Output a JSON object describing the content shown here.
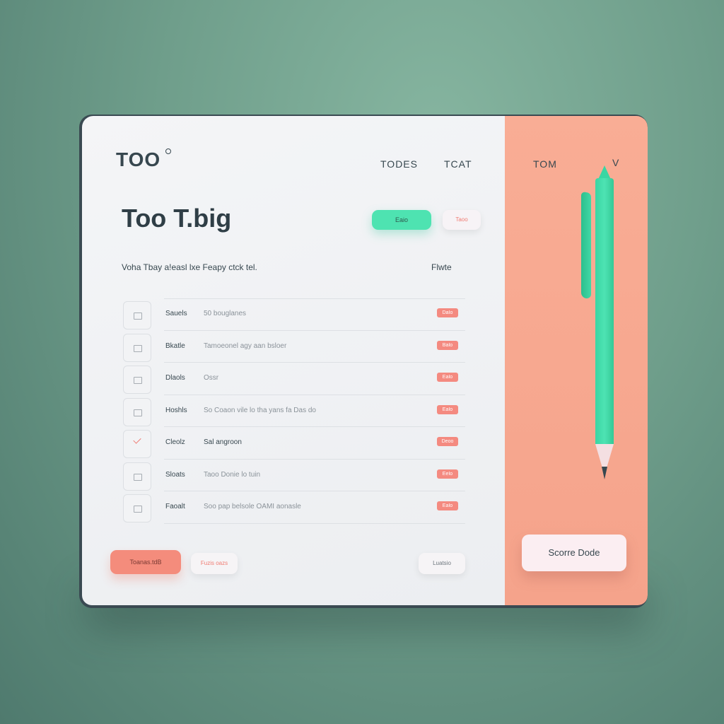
{
  "app": {
    "logo": "TOO",
    "title": "Too T.big",
    "subtitle": "Voha Tbay a!easl lxe Feapy ctck tel.",
    "subtitle_right": "Flwte"
  },
  "nav": {
    "links": [
      "TODES",
      "TCAT"
    ],
    "right_tab": "TOM",
    "right_chevron": "V"
  },
  "header_buttons": {
    "primary": "Eaio",
    "secondary": "Taoo"
  },
  "rows": [
    {
      "label": "Sauels",
      "desc": "50 bouglanes",
      "tag": "DaIo",
      "checked": false
    },
    {
      "label": "Bkatle",
      "desc": "Tamoeonel agy aan bsloer",
      "tag": "BaIo",
      "checked": false
    },
    {
      "label": "Dlaols",
      "desc": "Ossr",
      "tag": "EaIo",
      "checked": false
    },
    {
      "label": "Hoshls",
      "desc": "So Coaon vile lo tha yans fa Das do",
      "tag": "EaIo",
      "checked": false
    },
    {
      "label": "Cleolz",
      "desc": "Sal angroon",
      "tag": "Deoo",
      "checked": true
    },
    {
      "label": "Sloats",
      "desc": "Taoo Donie lo tuin",
      "tag": "EeIo",
      "checked": false
    },
    {
      "label": "Faoalt",
      "desc": "Soo pap belsole OAMI aonasle",
      "tag": "EaIo",
      "checked": false
    }
  ],
  "footer": {
    "primary": "Toanas.tdB",
    "secondary": "Fuzis oazs",
    "tertiary": "Luatsio"
  },
  "side": {
    "score_button": "Scorre Dode"
  },
  "colors": {
    "accent_green": "#4ee3b1",
    "accent_coral": "#f48c7c",
    "panel_peach": "#f7a890",
    "text_dark": "#37474f"
  }
}
